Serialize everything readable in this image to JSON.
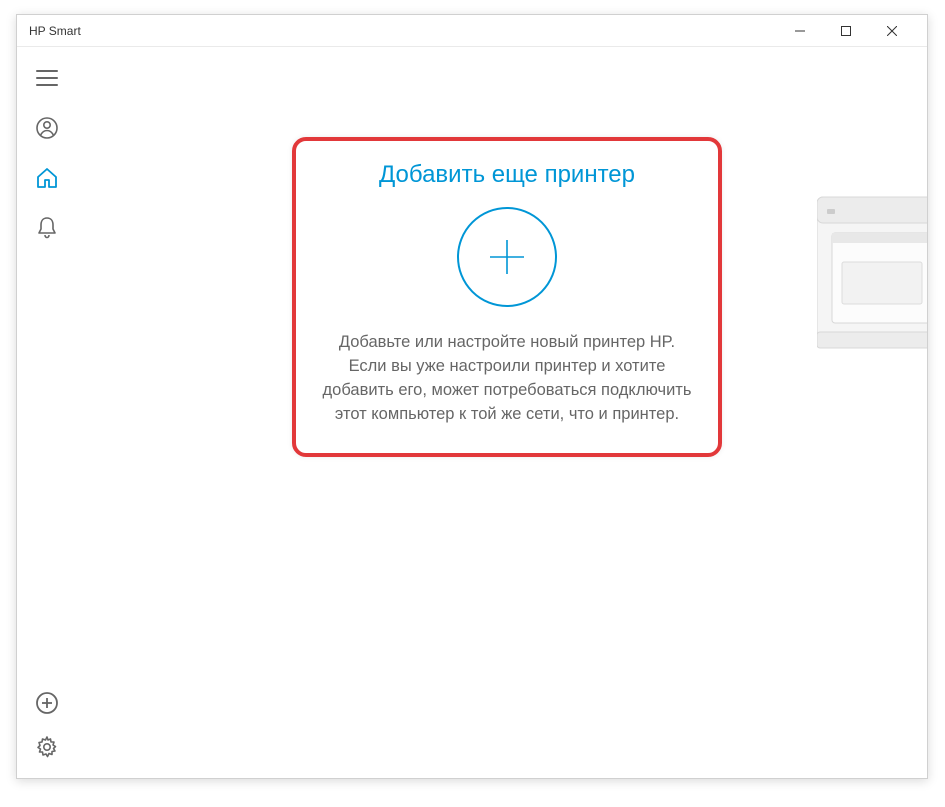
{
  "titlebar": {
    "title": "HP Smart"
  },
  "card": {
    "title": "Добавить еще принтер",
    "description": "Добавьте или настройте новый принтер HP. Если вы уже настроили принтер и хотите добавить его, может потребоваться подключить этот компьютер к той же сети, что и принтер."
  },
  "icons": {
    "hamburger": "menu",
    "account": "account",
    "home": "home",
    "bell": "notifications",
    "plus": "add",
    "settings": "settings"
  }
}
